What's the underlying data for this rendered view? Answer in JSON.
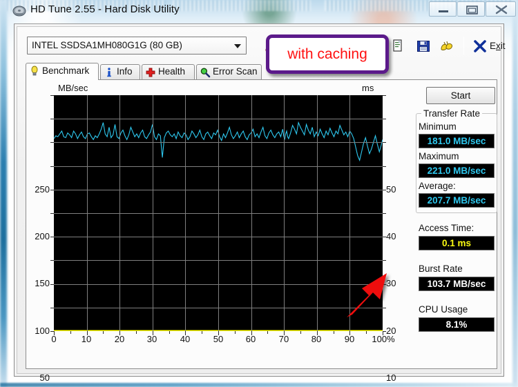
{
  "window": {
    "title": "HD Tune 2.55 - Hard Disk Utility",
    "app_icon": "hard-disk-icon",
    "buttons": {
      "minimize": "minimize",
      "maximize": "maximize",
      "close": "close"
    }
  },
  "toolbar": {
    "drive_selected": "INTEL SSDSA1MH080G1G (80 GB)",
    "icons": [
      {
        "name": "temperature-icon",
        "label": "Temperature"
      },
      {
        "name": "copy-icon",
        "label": "Copy"
      },
      {
        "name": "save-icon",
        "label": "Save"
      },
      {
        "name": "folder-icon",
        "label": "Open"
      }
    ],
    "exit_label": "Exit",
    "exit_accel": "x"
  },
  "tabs": [
    {
      "id": "benchmark",
      "label": "Benchmark",
      "icon": "bulb-icon",
      "active": true
    },
    {
      "id": "info",
      "label": "Info",
      "icon": "info-icon",
      "active": false
    },
    {
      "id": "health",
      "label": "Health",
      "icon": "cross-icon",
      "active": false
    },
    {
      "id": "errorscan",
      "label": "Error Scan",
      "icon": "magnifier-icon",
      "active": false
    }
  ],
  "panel": {
    "start_button": "Start",
    "transfer_rate_title": "Transfer Rate",
    "minimum_label": "Minimum",
    "minimum_value": "181.0 MB/sec",
    "maximum_label": "Maximum",
    "maximum_value": "221.0 MB/sec",
    "average_label": "Average:",
    "average_value": "207.7 MB/sec",
    "access_time_label": "Access Time:",
    "access_time_value": "0.1 ms",
    "burst_rate_label": "Burst Rate",
    "burst_rate_value": "103.7 MB/sec",
    "cpu_usage_label": "CPU Usage",
    "cpu_usage_value": "8.1%"
  },
  "annotations": {
    "callout_text": "with caching",
    "callout_border_color": "#5b1a8a",
    "callout_text_color": "#ff1111",
    "arrow_color": "#ee1111",
    "arrow_points_to": "access-time-value"
  },
  "colors": {
    "transfer_curve": "#2ec9f0",
    "access_curve": "#ffff00",
    "plot_background": "#000000",
    "grid": "#808080"
  },
  "chart_data": {
    "type": "line",
    "title": "",
    "xlabel": "",
    "ylabel": "MB/sec",
    "y2label": "ms",
    "xlim": [
      0,
      100
    ],
    "ylim": [
      0,
      250
    ],
    "y2lim": [
      0,
      50
    ],
    "grid": true,
    "legend": "none",
    "xticks": [
      0,
      10,
      20,
      30,
      40,
      50,
      60,
      70,
      80,
      90,
      100
    ],
    "xticklabels": [
      "0",
      "10",
      "20",
      "30",
      "40",
      "50",
      "60",
      "70",
      "80",
      "90",
      "100%"
    ],
    "yticks": [
      0,
      50,
      100,
      150,
      200,
      250
    ],
    "yticklabels": [
      "",
      "50",
      "100",
      "150",
      "200",
      "250"
    ],
    "y2ticks": [
      0,
      10,
      20,
      30,
      40,
      50
    ],
    "y2ticklabels": [
      "",
      "10",
      "20",
      "30",
      "40",
      "50"
    ],
    "series": [
      {
        "name": "Transfer Rate",
        "axis": "left",
        "color": "#2ec9f0",
        "units": "MB/sec",
        "x": [
          0,
          0.6,
          1.2,
          1.8,
          2.4,
          3,
          3.6,
          4.2,
          4.8,
          5.4,
          6,
          6.6,
          7.2,
          7.8,
          8.4,
          9,
          9.6,
          10.2,
          10.8,
          11.4,
          12,
          12.6,
          13.2,
          13.8,
          14.4,
          15,
          15.6,
          16.2,
          16.8,
          17.4,
          18,
          18.6,
          19.2,
          19.8,
          20.4,
          21,
          21.6,
          22.2,
          22.8,
          23.4,
          24,
          24.6,
          25.2,
          25.8,
          26.4,
          27,
          27.6,
          28.2,
          28.8,
          29.4,
          30,
          30.6,
          31.2,
          31.8,
          32.4,
          33,
          33.6,
          34.2,
          34.8,
          35.4,
          36,
          36.6,
          37.2,
          37.8,
          38.4,
          39,
          39.6,
          40.2,
          40.8,
          41.4,
          42,
          42.6,
          43.2,
          43.8,
          44.4,
          45,
          45.6,
          46.2,
          46.8,
          47.4,
          48,
          48.6,
          49.2,
          49.8,
          50.4,
          51,
          51.6,
          52.2,
          52.8,
          53.4,
          54,
          54.6,
          55.2,
          55.8,
          56.4,
          57,
          57.6,
          58.2,
          58.8,
          59.4,
          60,
          60.6,
          61.2,
          61.8,
          62.4,
          63,
          63.6,
          64.2,
          64.8,
          65.4,
          66,
          66.6,
          67.2,
          67.8,
          68.4,
          69,
          69.3,
          69.6,
          69.9,
          70.2,
          70.5,
          70.8,
          71.1,
          71.4,
          72,
          72.6,
          73.2,
          73.8,
          74.4,
          75,
          75.6,
          76.2,
          76.8,
          77.4,
          78,
          78.6,
          79.2,
          79.8,
          80.4,
          81,
          81.6,
          82.2,
          82.8,
          83.4,
          84,
          84.6,
          85.2,
          85.8,
          86.4,
          87,
          87.6,
          88.2,
          88.8,
          89.4,
          90,
          90.6,
          91.2,
          91.8,
          92.4,
          93,
          93.6,
          94.2,
          94.8,
          95.4,
          96,
          96.6,
          97.2,
          97.8,
          98.4,
          99,
          99.5,
          100
        ],
        "y": [
          204,
          207,
          206,
          209,
          212,
          206,
          205,
          210,
          208,
          205,
          212,
          209,
          204,
          208,
          211,
          206,
          204,
          209,
          210,
          206,
          203,
          207,
          205,
          209,
          214,
          221,
          209,
          206,
          216,
          205,
          208,
          219,
          206,
          204,
          210,
          213,
          207,
          203,
          208,
          216,
          211,
          206,
          209,
          205,
          210,
          213,
          206,
          204,
          208,
          211,
          219,
          206,
          203,
          209,
          207,
          184,
          205,
          210,
          212,
          208,
          206,
          209,
          204,
          211,
          207,
          205,
          210,
          208,
          203,
          206,
          212,
          209,
          205,
          208,
          213,
          206,
          203,
          209,
          211,
          207,
          204,
          210,
          208,
          213,
          206,
          202,
          209,
          205,
          210,
          216,
          208,
          204,
          207,
          211,
          205,
          209,
          212,
          206,
          203,
          208,
          210,
          214,
          206,
          209,
          205,
          211,
          216,
          207,
          204,
          210,
          213,
          208,
          205,
          209,
          211,
          206,
          210,
          214,
          207,
          203,
          209,
          212,
          206,
          204,
          210,
          218,
          214,
          209,
          221,
          216,
          212,
          208,
          219,
          213,
          209,
          216,
          206,
          211,
          207,
          214,
          209,
          205,
          212,
          208,
          215,
          210,
          206,
          212,
          209,
          218,
          213,
          208,
          211,
          206,
          212,
          209,
          204,
          195,
          186,
          181,
          190,
          199,
          205,
          196,
          188,
          193,
          200,
          207,
          198,
          190,
          196,
          203,
          209,
          214,
          206,
          199,
          192,
          200,
          207,
          213,
          218,
          211,
          203,
          196,
          204,
          211,
          216,
          208,
          200,
          193,
          186,
          181,
          190,
          198,
          205,
          212,
          218,
          210,
          203,
          196,
          204,
          212,
          207,
          199,
          192,
          200,
          209,
          215,
          221,
          213,
          205,
          198,
          191,
          185,
          196,
          204,
          210
        ]
      },
      {
        "name": "Access Time",
        "axis": "right",
        "color": "#ffff00",
        "units": "ms",
        "x": [
          0,
          5,
          10,
          15,
          20,
          25,
          30,
          35,
          40,
          45,
          50,
          55,
          60,
          65,
          70,
          75,
          80,
          85,
          90,
          95,
          100
        ],
        "y": [
          0.1,
          0.1,
          0.1,
          0.1,
          0.1,
          0.1,
          0.1,
          0.1,
          0.1,
          0.1,
          0.1,
          0.1,
          0.1,
          0.1,
          0.1,
          0.1,
          0.1,
          0.1,
          0.1,
          0.1,
          0.1
        ]
      }
    ]
  }
}
